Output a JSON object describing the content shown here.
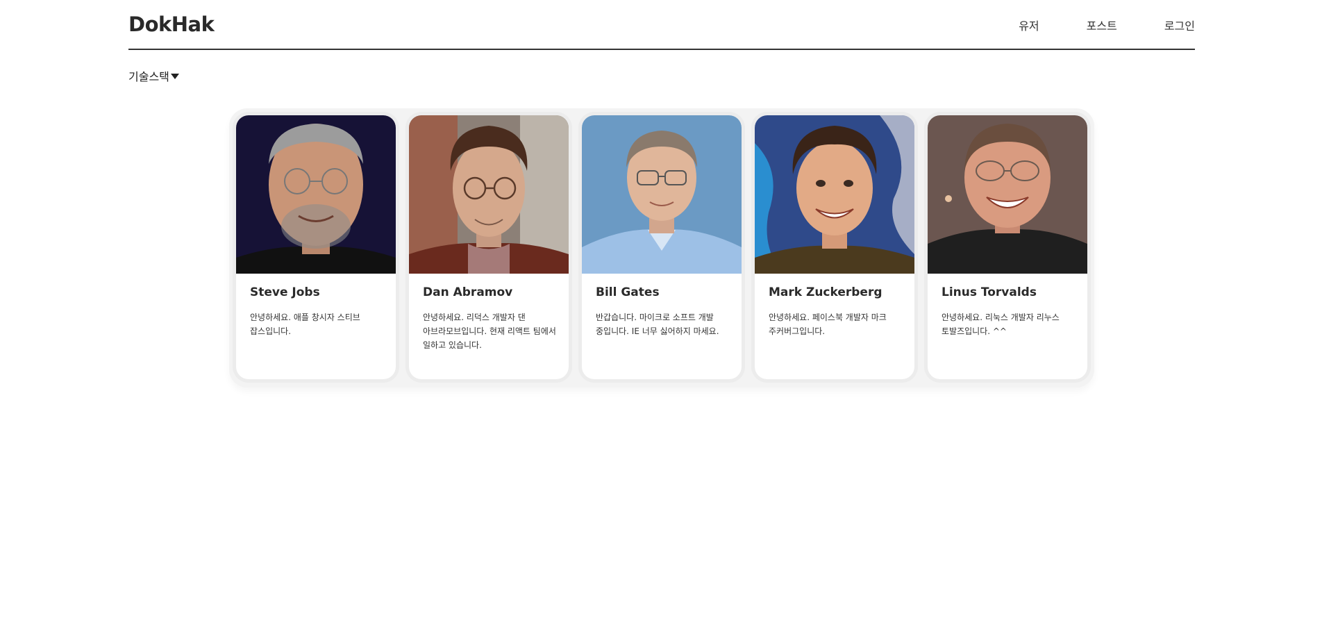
{
  "header": {
    "logo": "DokHak",
    "nav": [
      {
        "label": "유저"
      },
      {
        "label": "포스트"
      },
      {
        "label": "로그인"
      }
    ]
  },
  "filter": {
    "label": "기술스택"
  },
  "users": [
    {
      "name": "Steve Jobs",
      "bio": "안녕하세요. 애플 창시자 스티브 잡스입니다.",
      "photo_bg": "#141433"
    },
    {
      "name": "Dan Abramov",
      "bio": "안녕하세요. 리덕스 개발자 댄 아브라모브입니다. 현재 리액트 팀에서 일하고 있습니다.",
      "photo_bg": "#7a6a5c"
    },
    {
      "name": "Bill Gates",
      "bio": "반갑습니다. 마이크로 소프트 개발 중입니다. IE 너무 싫어하지 마세요.",
      "photo_bg": "#5f8fba"
    },
    {
      "name": "Mark Zuckerberg",
      "bio": "안녕하세요. 페이스북 개발자 마크 주커버그입니다.",
      "photo_bg": "#3b4a7a"
    },
    {
      "name": "Linus Torvalds",
      "bio": "안녕하세요. 리눅스 개발자 리누스 토발즈입니다. ^^",
      "photo_bg": "#5a4a44"
    }
  ]
}
